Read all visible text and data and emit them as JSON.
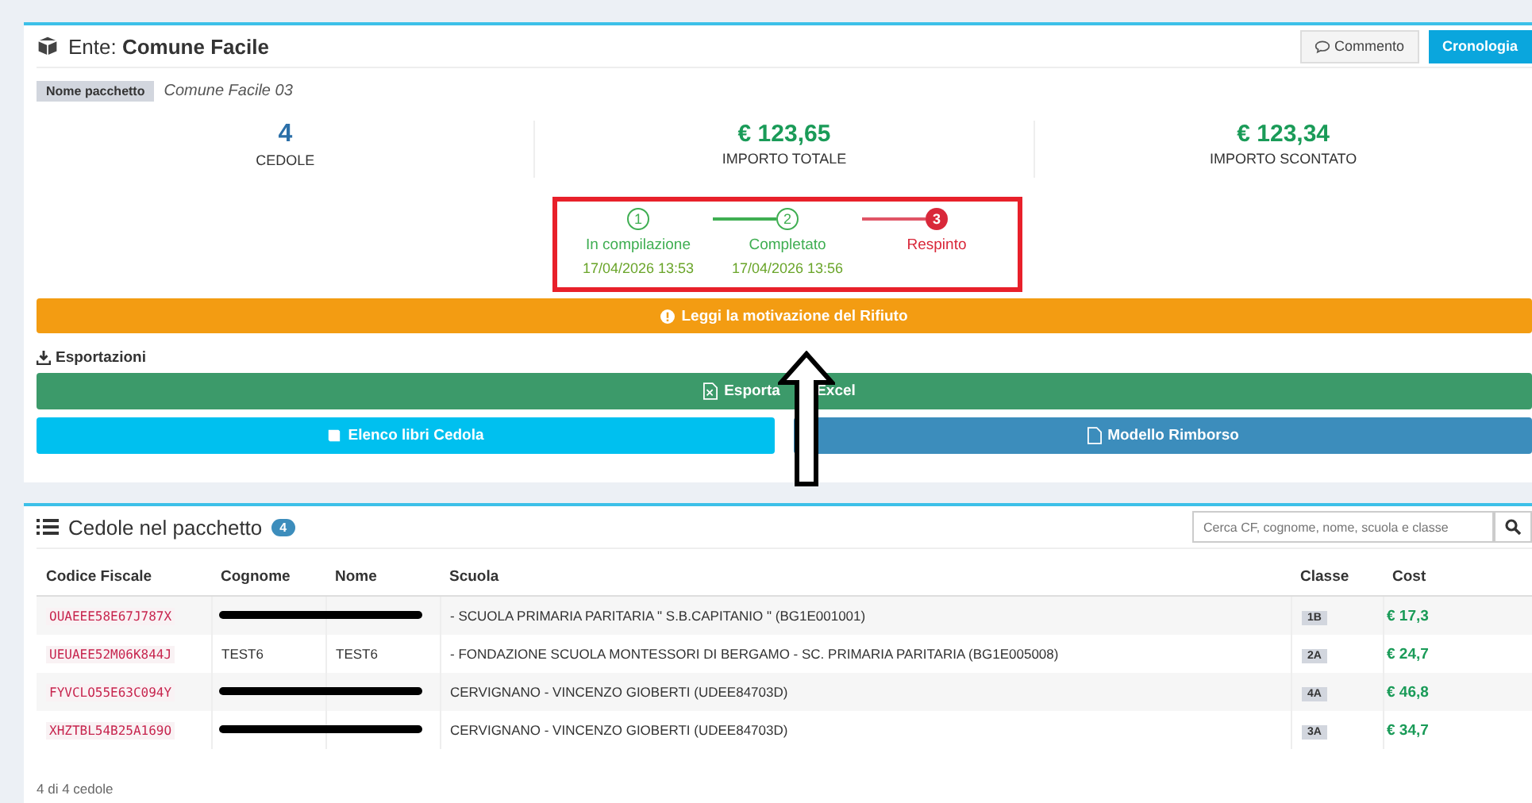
{
  "header": {
    "label": "Ente:",
    "entity": "Comune Facile",
    "buttons": [
      {
        "label": "Commento",
        "kind": "comment"
      },
      {
        "label": "Cronologia",
        "kind": "primary"
      }
    ]
  },
  "package": {
    "tag": "Nome pacchetto",
    "name": "Comune Facile 03"
  },
  "stats": [
    {
      "value": "4",
      "label": "CEDOLE",
      "kind": "count"
    },
    {
      "value": "€ 123,65",
      "label": "IMPORTO TOTALE",
      "kind": "money"
    },
    {
      "value": "€ 123,34",
      "label": "IMPORTO SCONTATO",
      "kind": "money"
    }
  ],
  "steps": [
    {
      "number": "1",
      "label": "In compilazione",
      "date": "17/04/2026 13:53",
      "rejected": false
    },
    {
      "number": "2",
      "label": "Completato",
      "date": "17/04/2026 13:56",
      "rejected": false
    },
    {
      "number": "3",
      "label": "Respinto",
      "rejected": true
    }
  ],
  "rejection_button": "Leggi la motivazione del Rifiuto",
  "exports": {
    "title": "Esportazioni",
    "excel": "Esporta Excel",
    "buttons": [
      {
        "label": "Elenco libri Cedola",
        "kind": "info"
      },
      {
        "label": "Modello Rimborso",
        "kind": "primary"
      }
    ]
  },
  "list": {
    "title": "Cedole nel pacchetto",
    "count": "4",
    "search": {
      "placeholder": "Cerca CF, cognome, nome, scuola e classe"
    },
    "table": {
      "columns": [
        "Codice Fiscale",
        "Cognome",
        "Nome",
        "Scuola",
        "Classe",
        "Cost"
      ],
      "rows": [
        {
          "codice": "OUAEEE58E67J787X",
          "redacted": true,
          "scuola": "- SCUOLA PRIMARIA PARITARIA \" S.B.CAPITANIO \" (BG1E001001)",
          "classe": "1B",
          "costo": "€ 17,3"
        },
        {
          "codice": "UEUAEE52M06K844J",
          "redacted": false,
          "cognome": "TEST6",
          "nome": "TEST6",
          "scuola": "- FONDAZIONE SCUOLA MONTESSORI DI BERGAMO - SC. PRIMARIA PARITARIA (BG1E005008)",
          "classe": "2A",
          "costo": "€ 24,7"
        },
        {
          "codice": "FYVCLO55E63C094Y",
          "redacted": true,
          "scuola": "CERVIGNANO - VINCENZO GIOBERTI (UDEE84703D)",
          "classe": "4A",
          "costo": "€ 46,8"
        },
        {
          "codice": "XHZTBL54B25A169O",
          "redacted": true,
          "scuola": "CERVIGNANO - VINCENZO GIOBERTI (UDEE84703D)",
          "classe": "3A",
          "costo": "€ 34,7"
        }
      ]
    },
    "footer": "4 di 4 cedole"
  }
}
